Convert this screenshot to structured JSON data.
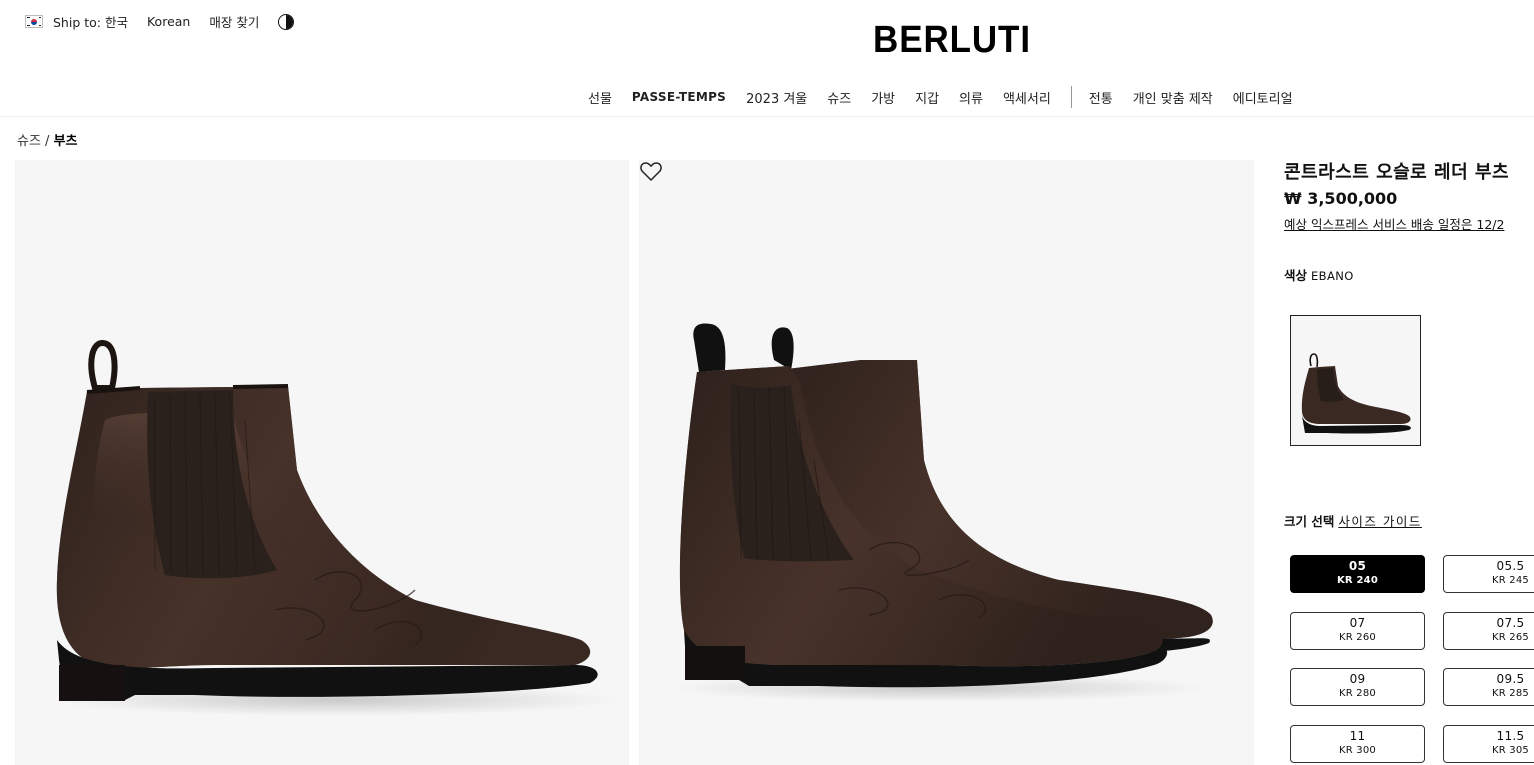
{
  "utility": {
    "ship_to": "Ship to: 한국",
    "language": "Korean",
    "store_locator": "매장 찾기"
  },
  "brand": {
    "logo": "BERLUTI"
  },
  "nav": {
    "left": [
      "선물",
      "PASSE-TEMPS",
      "2023 겨울",
      "슈즈",
      "가방",
      "지갑",
      "의류",
      "액세서리"
    ],
    "right": [
      "전통",
      "개인 맞춤 제작",
      "에디토리얼"
    ]
  },
  "breadcrumb": {
    "parent": "슈즈",
    "separator": " / ",
    "current": "부츠"
  },
  "product": {
    "title": "콘트라스트 오슬로 레더 부츠",
    "price": "₩ 3,500,000",
    "shipping": "예상 익스프레스 서비스 배송 일정은 12/2",
    "color_label": "색상",
    "color_value": "EBANO",
    "size_label": "크기 선택",
    "size_guide": "사이즈 가이드",
    "sizes": [
      {
        "eu": "05",
        "kr": "KR 240",
        "selected": true
      },
      {
        "eu": "05.5",
        "kr": "KR 245",
        "selected": false
      },
      {
        "eu": "07",
        "kr": "KR 260",
        "selected": false
      },
      {
        "eu": "07.5",
        "kr": "KR 265",
        "selected": false
      },
      {
        "eu": "09",
        "kr": "KR 280",
        "selected": false
      },
      {
        "eu": "09.5",
        "kr": "KR 285",
        "selected": false
      },
      {
        "eu": "11",
        "kr": "KR 300",
        "selected": false
      },
      {
        "eu": "11.5",
        "kr": "KR 305",
        "selected": false
      }
    ]
  },
  "colors": {
    "leather": "#3b2a24",
    "leather_dark": "#1f1613",
    "elastic": "#2a211c",
    "sole": "#111111",
    "panel": "#f6f6f6"
  }
}
